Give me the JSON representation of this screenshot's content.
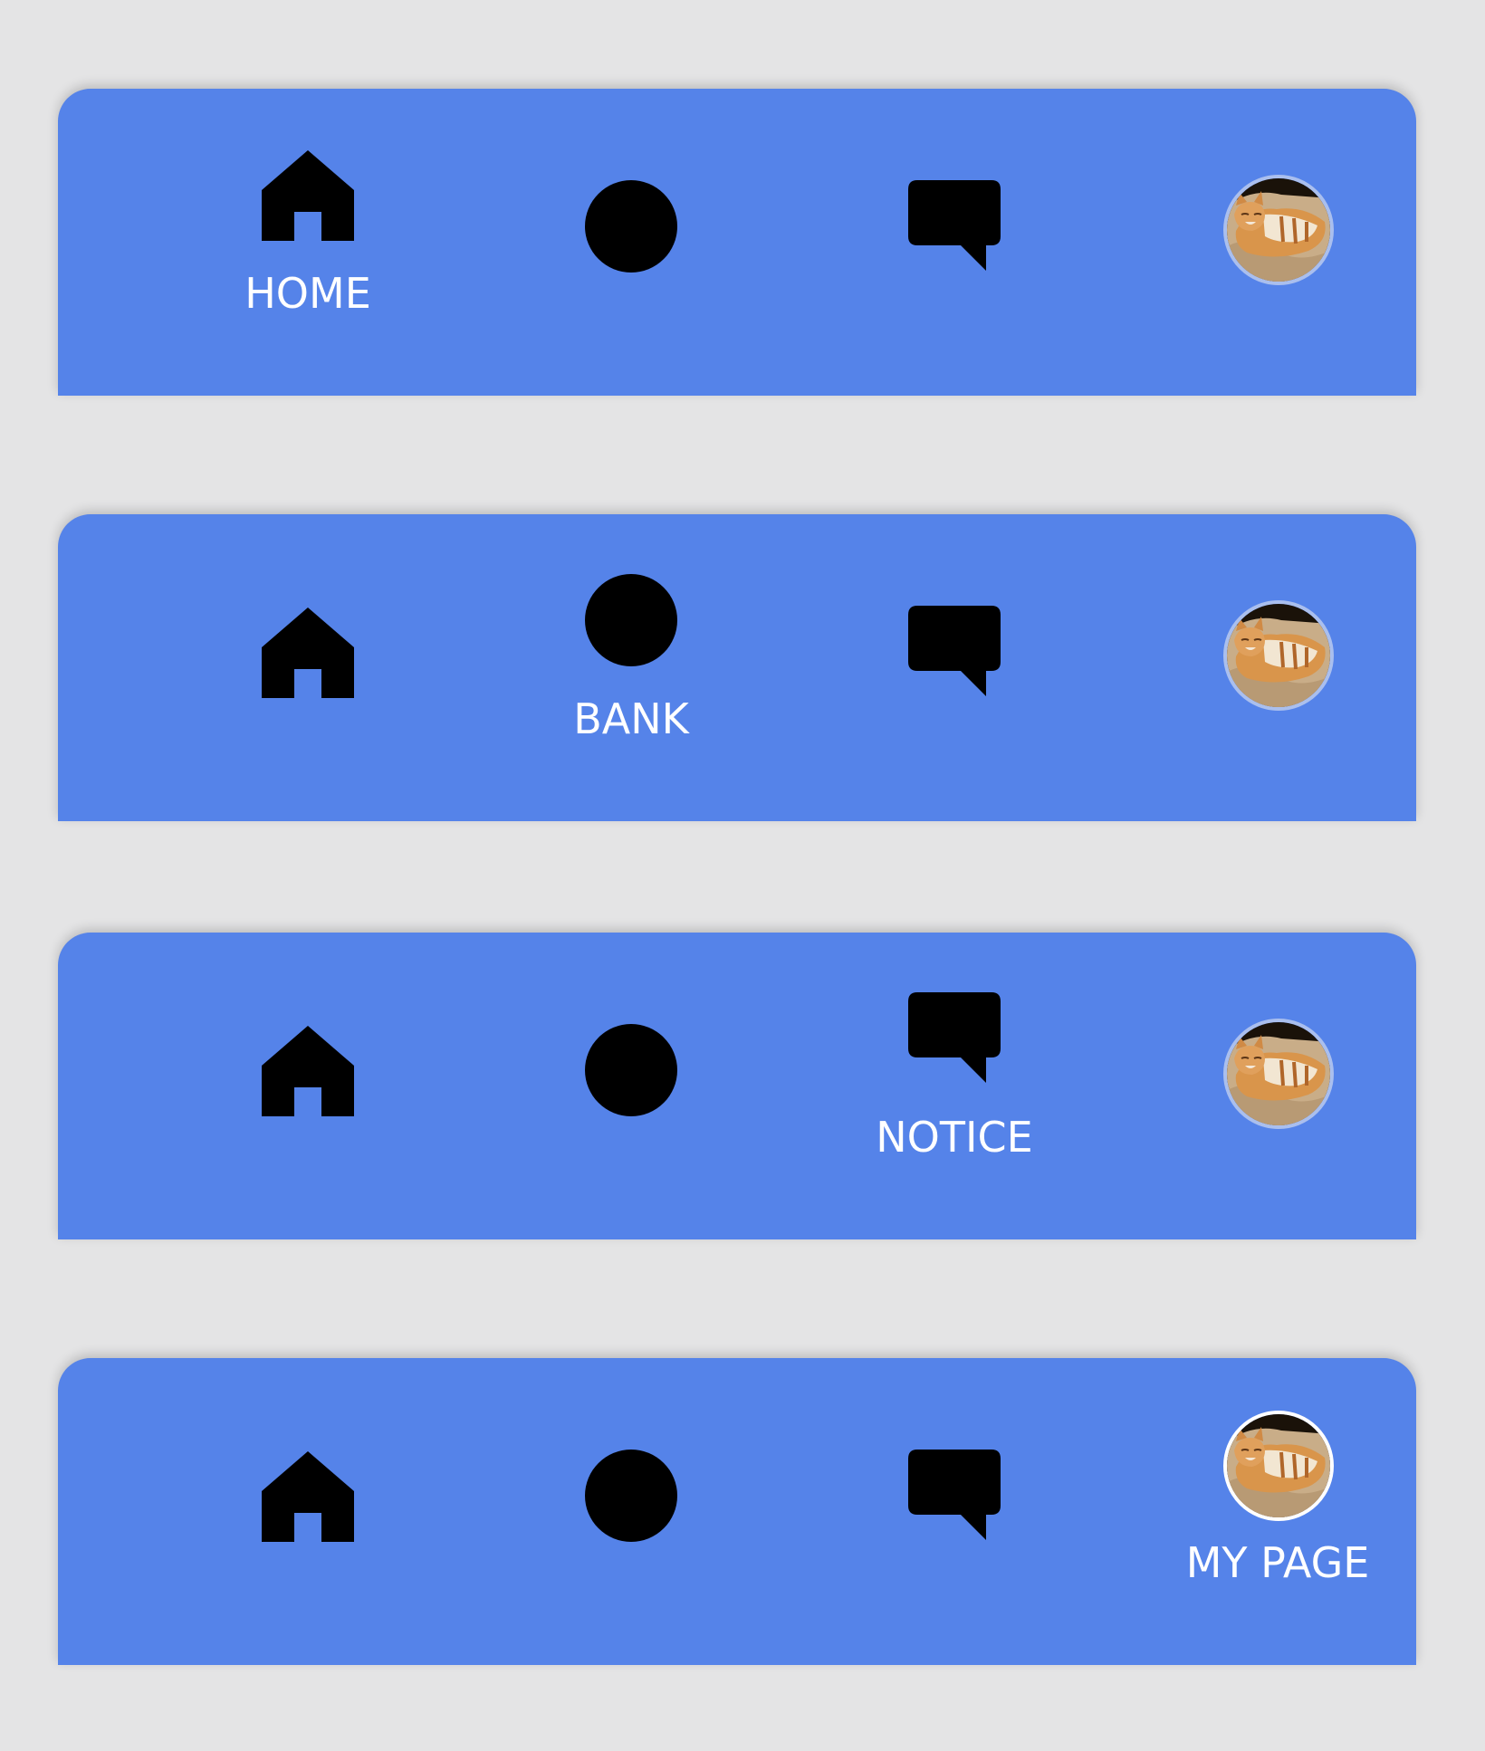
{
  "colors": {
    "background": "#e4e4e5",
    "bar": "#5583e9",
    "icon_inactive": "#aabfee",
    "icon_active": "#ffffff",
    "label": "#ffffff"
  },
  "nav_items": [
    {
      "id": "home",
      "label": "HOME",
      "icon": "home-icon"
    },
    {
      "id": "bank",
      "label": "BANK",
      "icon": "won-circle-icon"
    },
    {
      "id": "notice",
      "label": "NOTICE",
      "icon": "chat-bubble-icon"
    },
    {
      "id": "mypage",
      "label": "MY PAGE",
      "icon": "avatar"
    }
  ],
  "bars": [
    {
      "state": "home-selected",
      "active_index": 0,
      "active_label": "HOME"
    },
    {
      "state": "bank-selected",
      "active_index": 1,
      "active_label": "BANK"
    },
    {
      "state": "notice-selected",
      "active_index": 2,
      "active_label": "NOTICE"
    },
    {
      "state": "mypage-selected",
      "active_index": 3,
      "active_label": "MY PAGE"
    }
  ]
}
